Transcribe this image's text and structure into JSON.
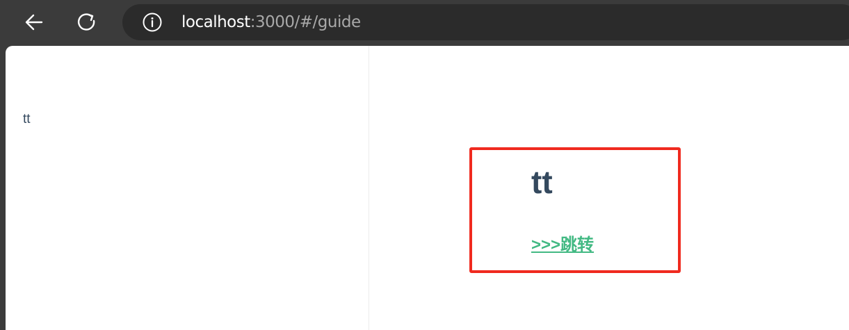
{
  "browser": {
    "back_icon": "arrow-left-icon",
    "refresh_icon": "refresh-icon",
    "info_icon": "info-icon",
    "url_host": "localhost",
    "url_path": ":3000/#/guide"
  },
  "left_panel": {
    "text": "tt"
  },
  "main": {
    "title": "tt",
    "link_label": ">>>跳转",
    "highlight_color": "#f02a1f",
    "link_color": "#42b983",
    "text_color": "#34495e"
  }
}
